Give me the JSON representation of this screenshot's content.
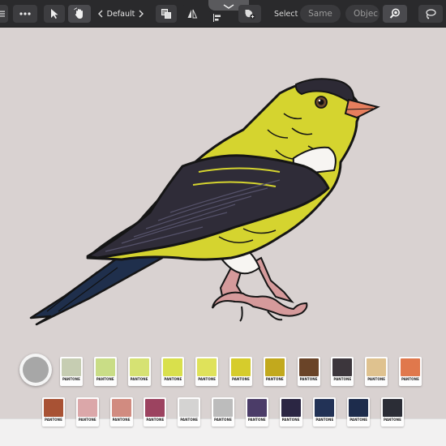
{
  "toolbar": {
    "style_name": "Default",
    "select_label": "Select",
    "same_label": "Same",
    "object_label": "Objec"
  },
  "icons": {
    "menu": "hamburger-menu-icon",
    "more": "more-dots-icon",
    "pointer": "pointer-arrow-icon",
    "hand": "hand-select-icon",
    "prev": "chevron-left-icon",
    "next": "chevron-right-icon",
    "boolean": "boolean-ops-icon",
    "flip": "flip-icon",
    "align": "align-icon",
    "add_shape": "add-shape-icon",
    "zoom": "zoom-search-icon",
    "lasso": "lasso-icon",
    "collapse": "chevron-down-icon"
  },
  "canvas": {
    "background": "#d9d2d1",
    "subject": "goldfinch-illustration"
  },
  "palette": {
    "current_color": "#a7a7a7",
    "row1": [
      {
        "label": "PANTONE",
        "color": "#c6cdb2"
      },
      {
        "label": "PANTONE",
        "color": "#c9dd86"
      },
      {
        "label": "PANTONE",
        "color": "#d6e273"
      },
      {
        "label": "PANTONE",
        "color": "#d9e04c"
      },
      {
        "label": "PANTONE",
        "color": "#dfe25a"
      },
      {
        "label": "PANTONE",
        "color": "#d6cc2c"
      },
      {
        "label": "PANTONE",
        "color": "#c2a91d"
      },
      {
        "label": "PANTONE",
        "color": "#6a4428"
      },
      {
        "label": "PANTONE",
        "color": "#3c363c"
      },
      {
        "label": "PANTONE",
        "color": "#dfc28f"
      },
      {
        "label": "PANTONE",
        "color": "#e0784c"
      }
    ],
    "row2": [
      {
        "label": "PANTONE",
        "color": "#a85234"
      },
      {
        "label": "PANTONE",
        "color": "#dba7a9"
      },
      {
        "label": "PANTONE",
        "color": "#d18b80"
      },
      {
        "label": "PANTONE",
        "color": "#9c4360"
      },
      {
        "label": "PANTONE",
        "color": "#d4d3d2"
      },
      {
        "label": "PANTONE",
        "color": "#bcbcbc"
      },
      {
        "label": "PANTONE",
        "color": "#4b3c68"
      },
      {
        "label": "PANTONE",
        "color": "#2b2643"
      },
      {
        "label": "PANTONE",
        "color": "#223256"
      },
      {
        "label": "PANTONE",
        "color": "#1d2c4c"
      },
      {
        "label": "PANTONE",
        "color": "#2b2d36"
      }
    ]
  }
}
